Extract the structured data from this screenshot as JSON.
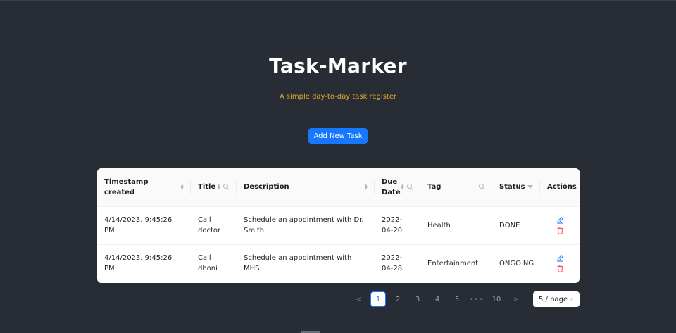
{
  "header": {
    "title": "Task-Marker",
    "subtitle": "A simple day-to-day task register",
    "add_button": "Add New Task"
  },
  "table": {
    "columns": {
      "timestamp": "Timestamp created",
      "title": "Title",
      "description": "Description",
      "due_date": "Due Date",
      "tag": "Tag",
      "status": "Status",
      "actions": "Actions"
    },
    "rows": [
      {
        "timestamp": "4/14/2023, 9:45:26 PM",
        "title": "Call doctor",
        "description": "Schedule an appointment with Dr. Smith",
        "due_date": "2022-04-20",
        "tag": "Health",
        "status": "DONE"
      },
      {
        "timestamp": "4/14/2023, 9:45:26 PM",
        "title": "Call dhoni",
        "description": "Schedule an appointment with MHS",
        "due_date": "2022-04-28",
        "tag": "Entertainment",
        "status": "ONGOING"
      }
    ]
  },
  "pagination": {
    "prev": "<",
    "pages": [
      "1",
      "2",
      "3",
      "4",
      "5"
    ],
    "ellipsis": "•••",
    "last": "10",
    "next": ">",
    "current": "1",
    "page_size": "5 / page"
  },
  "colors": {
    "background": "#282c34",
    "accent": "#1677ff",
    "subtitle": "#e0a82e",
    "delete": "#ff4d4f"
  }
}
